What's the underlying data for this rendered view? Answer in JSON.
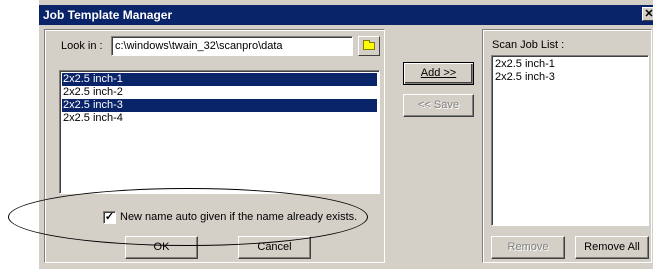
{
  "window": {
    "title": "Job Template Manager",
    "close_glyph": "✕"
  },
  "look_in": {
    "label": "Look in :",
    "value": "c:\\windows\\twain_32\\scanpro\\data",
    "browse_icon": "folder-icon"
  },
  "templates": {
    "items": [
      {
        "label": "2x2.5 inch-1",
        "selected": true
      },
      {
        "label": "2x2.5 inch-2",
        "selected": false
      },
      {
        "label": "2x2.5 inch-3",
        "selected": true
      },
      {
        "label": "2x2.5 inch-4",
        "selected": false
      }
    ]
  },
  "auto_name": {
    "checked": true,
    "check_glyph": "✓",
    "label": "New name auto given if the name already exists."
  },
  "buttons": {
    "ok": "OK",
    "cancel": "Cancel",
    "add": "Add >>",
    "save": "<< Save",
    "remove": "Remove",
    "remove_all": "Remove All"
  },
  "scan_job": {
    "label": "Scan Job List :",
    "items": [
      "2x2.5 inch-1",
      "2x2.5 inch-3"
    ]
  },
  "colors": {
    "window_bg": "#d4d0c8",
    "title_bar": "#0a246a",
    "selection": "#0a246a",
    "disabled_text": "#808080"
  }
}
